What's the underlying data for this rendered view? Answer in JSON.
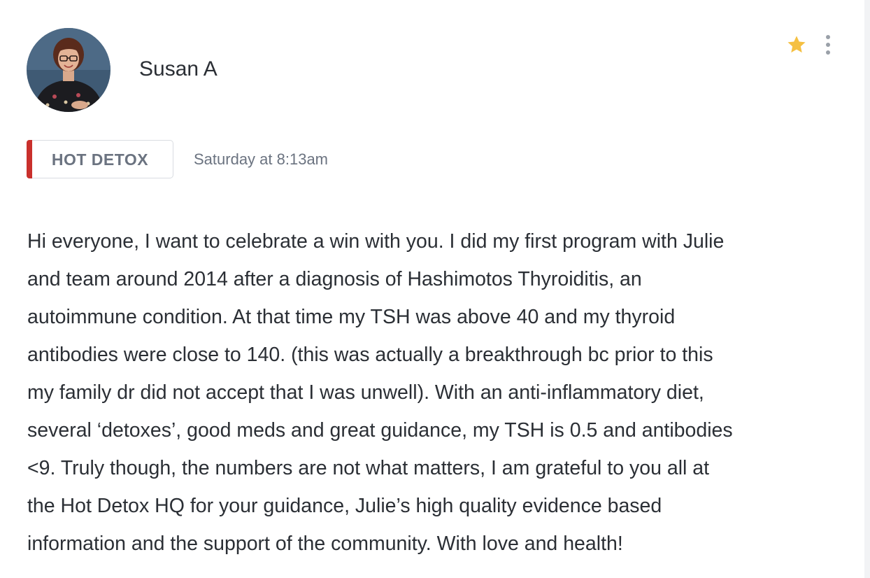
{
  "post": {
    "author": {
      "name": "Susan A",
      "avatar_icon": "user-photo"
    },
    "starred": true,
    "star_color": "#f5c042",
    "menu_icon": "more-vertical-icon",
    "category": {
      "label": "HOT DETOX",
      "accent_color": "#c9302c"
    },
    "timestamp": "Saturday at 8:13am",
    "body_lines": [
      "Hi everyone, I want to celebrate a win with you. I did my first program with Julie",
      "and team around 2014 after a diagnosis of Hashimotos Thyroiditis, an",
      "autoimmune condition. At that time my TSH was above 40 and my thyroid",
      "antibodies were close to 140.  (this was actually a breakthrough bc prior to this",
      "my family dr did not accept that I was unwell). With an anti-inflammatory diet,",
      "several ‘detoxes’, good meds and great guidance, my TSH is 0.5 and antibodies",
      "<9.  Truly though, the numbers are not what matters, I am grateful to you all at",
      "the Hot Detox HQ for your guidance, Julie’s  high quality evidence based",
      "information and the support of the community. With love and health!"
    ]
  }
}
